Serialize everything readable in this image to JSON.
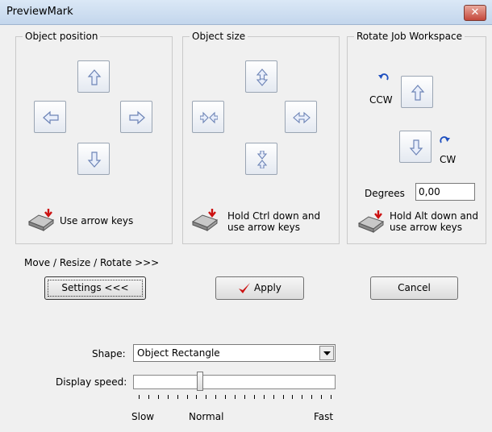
{
  "window": {
    "title": "PreviewMark",
    "close_glyph": "✕"
  },
  "groups": {
    "position": {
      "label": "Object position",
      "hint": "Use arrow keys"
    },
    "size": {
      "label": "Object size",
      "hint_line1": "Hold Ctrl down and",
      "hint_line2": "use arrow keys"
    },
    "rotate": {
      "label": "Rotate Job Workspace",
      "ccw_label": "CCW",
      "cw_label": "CW",
      "degrees_label": "Degrees",
      "degrees_value": "0,00",
      "hint_line1": "Hold Alt down and",
      "hint_line2": "use arrow keys"
    }
  },
  "section": {
    "move_label": "Move / Resize / Rotate >>>"
  },
  "buttons": {
    "settings": "Settings <<<",
    "apply": "Apply",
    "cancel": "Cancel"
  },
  "shape": {
    "label": "Shape:",
    "value": "Object Rectangle"
  },
  "speed": {
    "label": "Display speed:",
    "slow": "Slow",
    "normal": "Normal",
    "fast": "Fast",
    "level_fraction": 0.32,
    "tick_count": 21
  },
  "colors": {
    "arrow_fill": "#e8eefb",
    "arrow_stroke": "#6d84b6",
    "accent_red": "#cc1111",
    "rotate_blue": "#2050c0"
  },
  "icons": [
    "arrow-up-icon",
    "arrow-down-icon",
    "arrow-left-icon",
    "arrow-right-icon",
    "keyboard-icon",
    "check-icon",
    "rotate-ccw-icon",
    "rotate-cw-icon",
    "dropdown-arrow-icon"
  ]
}
